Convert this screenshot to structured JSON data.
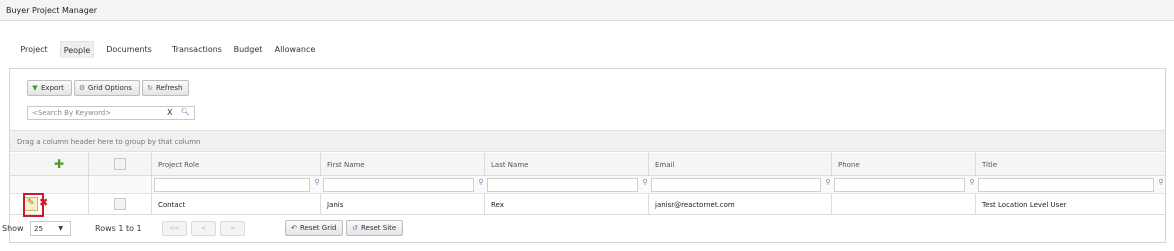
{
  "app": {
    "title": "Buyer Project Manager"
  },
  "tabs": [
    {
      "label": "Project",
      "active": false
    },
    {
      "label": "People",
      "active": true
    },
    {
      "label": "Documents",
      "active": false
    },
    {
      "label": "Transactions",
      "active": false
    },
    {
      "label": "Budget",
      "active": false
    },
    {
      "label": "Allowance",
      "active": false
    }
  ],
  "toolbar": {
    "export_label": "Export",
    "grid_options_label": "Grid Options",
    "refresh_label": "Refresh"
  },
  "search": {
    "placeholder": "<Search By Keyword>",
    "clear_label": "X"
  },
  "group_hint": "Drag a column header here to group by that column",
  "grid": {
    "columns": [
      "Project Role",
      "First Name",
      "Last Name",
      "Email",
      "Phone",
      "Title"
    ],
    "rows": [
      {
        "project_role": "Contact",
        "first_name": "Janis",
        "last_name": "Rex",
        "email": "janisr@reactornet.com",
        "phone": "",
        "title": "Test Location Level User"
      }
    ]
  },
  "footer": {
    "show_label": "Show",
    "page_size": "25",
    "rows_text": "Rows 1 to 1",
    "pager": [
      "<<",
      "<",
      ">"
    ],
    "reset_grid_label": "Reset Grid",
    "reset_site_label": "Reset Site"
  },
  "icons": {
    "export": "download-arrow-icon",
    "grid_options": "gear-icon",
    "refresh": "refresh-icon",
    "search": "magnifier-icon",
    "add": "plus-icon",
    "edit": "pencil-icon",
    "delete": "x-icon",
    "filter": "funnel-icon"
  },
  "colors": {
    "add_green": "#4b9a2a",
    "delete_red": "#c8191f",
    "highlight_red": "#d0182a",
    "filter_blue": "#5a8ac0"
  }
}
